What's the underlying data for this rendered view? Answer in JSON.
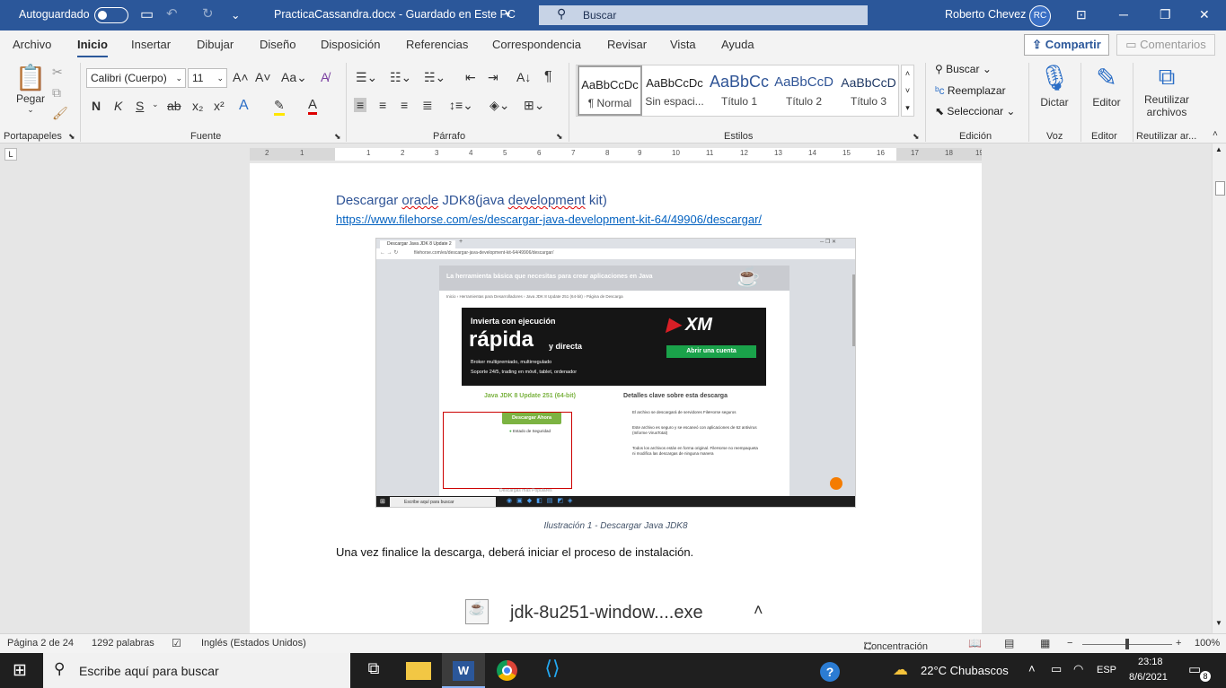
{
  "titlebar": {
    "autosave_label": "Autoguardado",
    "doc_title": "PracticaCassandra.docx  -  Guardado en Este PC",
    "search_placeholder": "Buscar",
    "user_name": "Roberto Chevez",
    "user_initials": "RC"
  },
  "tabs": [
    "Archivo",
    "Inicio",
    "Insertar",
    "Dibujar",
    "Diseño",
    "Disposición",
    "Referencias",
    "Correspondencia",
    "Revisar",
    "Vista",
    "Ayuda"
  ],
  "share_label": "Compartir",
  "comments_label": "Comentarios",
  "ribbon": {
    "paste_label": "Pegar",
    "font_name": "Calibri (Cuerpo)",
    "font_size": "11",
    "styles": [
      {
        "preview": "AaBbCcDc",
        "name": "¶ Normal"
      },
      {
        "preview": "AaBbCcDc",
        "name": "Sin espaci..."
      },
      {
        "preview": "AaBbCc",
        "name": "Título 1"
      },
      {
        "preview": "AaBbCcD",
        "name": "Título 2"
      },
      {
        "preview": "AaBbCcD",
        "name": "Título 3"
      }
    ],
    "find_label": "Buscar",
    "replace_label": "Reemplazar",
    "select_label": "Seleccionar",
    "dictate_label": "Dictar",
    "editor_label": "Editor",
    "reuse_label_1": "Reutilizar",
    "reuse_label_2": "archivos",
    "groups": {
      "clipboard": "Portapapeles",
      "font": "Fuente",
      "paragraph": "Párrafo",
      "styles": "Estilos",
      "editing": "Edición",
      "voice": "Voz",
      "editor": "Editor",
      "reuse": "Reutilizar ar..."
    }
  },
  "ruler_numbers": [
    "2",
    "1",
    "1",
    "2",
    "3",
    "4",
    "5",
    "6",
    "7",
    "8",
    "9",
    "10",
    "11",
    "12",
    "13",
    "14",
    "15",
    "16",
    "17",
    "18",
    "19"
  ],
  "document": {
    "heading_prefix": "Descargar ",
    "heading_oracle": "oracle",
    "heading_mid": " JDK8(java ",
    "heading_dev": "development",
    "heading_suffix": " kit)",
    "link": "https://www.filehorse.com/es/descargar-java-development-kit-64/49906/descargar/",
    "caption": "Ilustración 1 - Descargar Java JDK8",
    "body_text": "Una vez finalice la descarga, deberá iniciar el proceso de instalación.",
    "download_file": "jdk-8u251-window....exe"
  },
  "screenshot": {
    "tab_title": "Descargar Java JDK 8 Update 2",
    "url": "filehorse.com/es/descargar-java-development-kit-64/49906/descargar/",
    "banner": "La herramienta básica que necesitas para crear aplicaciones en Java",
    "breadcrumb": "Inicio  ›  Herramientas para Desarrolladores  ›  Java JDK 8 Update 251 (64-bit)  ›  Página de Descarga",
    "ad_line1": "Invierta con ejecución",
    "ad_big": "rápida",
    "ad_small": "y directa",
    "ad_b1": "Broker multipremiado, multirregulado",
    "ad_b2": "Soporte 24/5, trading en móvil, tablet, ordenador",
    "ad_brand": "XM",
    "ad_cta": "Abrir una cuenta",
    "product_title": "Java JDK 8 Update 251 (64-bit)",
    "download_btn": "Descargar Ahora",
    "security": "Estado de Seguridad",
    "details_title": "Detalles clave sobre esta descarga",
    "detail1": "El archivo se descargará de servidores FileHorse seguros",
    "detail2": "Este archivo es seguro y se escaneó con aplicaciones de 62 antivirus (Informe VirusTotal)",
    "detail3": "Todos los archivos están en forma original. FileHorse no reempaqueta ni modifica las descargas de ninguna manera",
    "taskbar_search": "Escribe aquí para buscar",
    "more": "Descargas más Populares"
  },
  "status": {
    "page": "Página 2 de 24",
    "words": "1292 palabras",
    "language": "Inglés (Estados Unidos)",
    "focus": "Concentración",
    "zoom": "100%"
  },
  "taskbar": {
    "search_placeholder": "Escribe aquí para buscar",
    "weather": "22°C  Chubascos",
    "lang": "ESP",
    "time": "23:18",
    "date": "8/6/2021",
    "notifications": "8"
  }
}
